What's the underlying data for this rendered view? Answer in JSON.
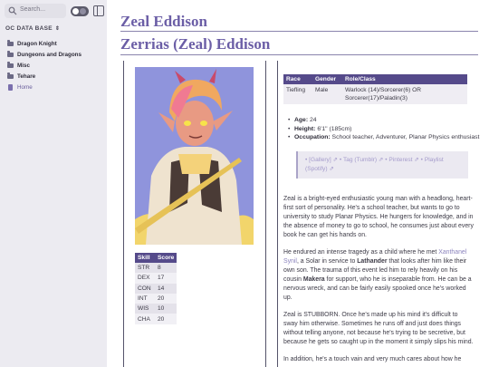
{
  "sidebar": {
    "search_placeholder": "Search...",
    "vault_name": "OC DATA BASE",
    "items": [
      {
        "label": "Dragon Knight",
        "type": "folder"
      },
      {
        "label": "Dungeons and Dragons",
        "type": "folder"
      },
      {
        "label": "Misc",
        "type": "folder"
      },
      {
        "label": "Tehare",
        "type": "folder"
      },
      {
        "label": "Home",
        "type": "file"
      }
    ]
  },
  "page": {
    "title": "Zeal Eddison",
    "subtitle": "Zerrias (Zeal) Eddison"
  },
  "stats": {
    "headers": [
      "Skill",
      "Score"
    ],
    "rows": [
      [
        "STR",
        "8"
      ],
      [
        "DEX",
        "17"
      ],
      [
        "CON",
        "14"
      ],
      [
        "INT",
        "20"
      ],
      [
        "WIS",
        "10"
      ],
      [
        "CHA",
        "20"
      ]
    ]
  },
  "info_table": {
    "headers": [
      "Race",
      "Gender",
      "Role/Class"
    ],
    "row": [
      "Tiefling",
      "Male",
      "Warlock (14)/Sorcerer(6) OR Sorcerer(17)/Paladin(3)"
    ]
  },
  "bullets": [
    {
      "label": "Age:",
      "value": "24"
    },
    {
      "label": "Height:",
      "value": "6'1\" (185cm)"
    },
    {
      "label": "Occupation:",
      "value": "School teacher, Adventurer, Planar Physics enthusiast"
    }
  ],
  "links": {
    "l1": "[Gallery]",
    "l2": "Tag (Tumblr)",
    "l3": "Pinterest",
    "l4": "Playlist (Spotify)"
  },
  "paragraphs": {
    "p1": "Zeal is a bright-eyed enthusiastic young man with a headlong, heart-first sort of personality. He's a school teacher, but wants to go to university to study Planar Physics. He hungers for knowledge, and in the absence of money to go to school, he consumes just about every book he can get his hands on.",
    "p2a": "He endured an intense tragedy as a child where he met ",
    "p2b": "Xanthanel Synil",
    "p2c": ", a Solar in service to ",
    "p2d": "Lathander",
    "p2e": " that looks after him like their own son. The trauma of this event led him to rely heavily on his cousin ",
    "p2f": "Makera",
    "p2g": " for support, who he is inseparable from. He can be a nervous wreck, and can be fairly easily spooked once he's worked up.",
    "p3": "Zeal is STUBBORN. Once he's made up his mind it's difficult to sway him otherwise. Sometimes he runs off and just does things without telling anyone, not because he's trying to be secretive, but because he gets so caught up in the moment it simply slips his mind.",
    "p4": "In addition, he's a touch vain and very much cares about how he"
  },
  "colors": {
    "accent": "#6b5ea6",
    "table_header": "#554a8a"
  }
}
